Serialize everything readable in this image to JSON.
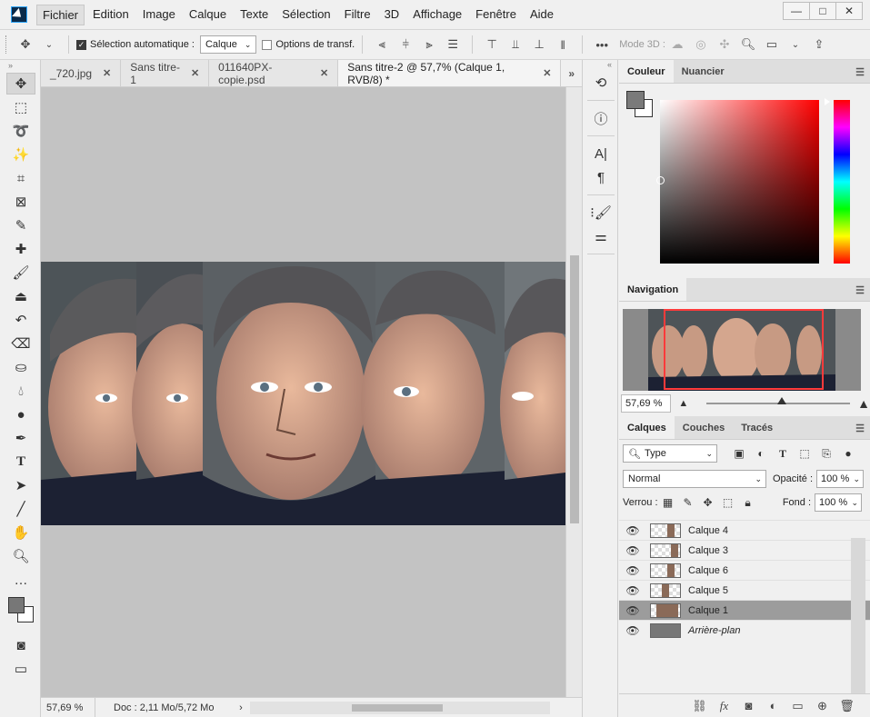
{
  "menubar": {
    "items": [
      "Fichier",
      "Edition",
      "Image",
      "Calque",
      "Texte",
      "Sélection",
      "Filtre",
      "3D",
      "Affichage",
      "Fenêtre",
      "Aide"
    ],
    "active_index": 0,
    "window_controls": [
      "—",
      "□",
      "✕"
    ]
  },
  "options": {
    "auto_select_label": "Sélection automatique :",
    "auto_select_checked": true,
    "auto_select_target": "Calque",
    "transform_label": "Options de transf.",
    "transform_checked": false,
    "mode3d_label": "Mode 3D :",
    "more_label": "•••"
  },
  "tabs": [
    {
      "label": "_720.jpg",
      "active": false
    },
    {
      "label": "Sans titre-1",
      "active": false
    },
    {
      "label": "011640PX-copie.psd",
      "active": false
    },
    {
      "label": "Sans titre-2 @ 57,7% (Calque 1, RVB/8) *",
      "active": true
    }
  ],
  "status": {
    "zoom": "57,69 %",
    "doc": "Doc : 2,11 Mo/5,72 Mo"
  },
  "panels": {
    "color": {
      "tabs": [
        "Couleur",
        "Nuancier"
      ],
      "active": 0
    },
    "navigation": {
      "tabs": [
        "Navigation"
      ],
      "zoom": "57,69 %"
    },
    "layers": {
      "tabs": [
        "Calques",
        "Couches",
        "Tracés"
      ],
      "filter_type": "Type",
      "blend_mode": "Normal",
      "opacity_label": "Opacité :",
      "opacity_value": "100 %",
      "lock_label": "Verrou :",
      "fill_label": "Fond :",
      "fill_value": "100 %",
      "items": [
        {
          "name": "Calque 4",
          "selected": false,
          "italic": false,
          "locked": false
        },
        {
          "name": "Calque 3",
          "selected": false,
          "italic": false,
          "locked": false
        },
        {
          "name": "Calque 6",
          "selected": false,
          "italic": false,
          "locked": false
        },
        {
          "name": "Calque 5",
          "selected": false,
          "italic": false,
          "locked": false
        },
        {
          "name": "Calque 1",
          "selected": true,
          "italic": false,
          "locked": false
        },
        {
          "name": "Arrière-plan",
          "selected": false,
          "italic": true,
          "locked": true
        }
      ],
      "footer_fx": "fx"
    }
  },
  "tools": [
    "move-tool",
    "marquee-tool",
    "lasso-tool",
    "magic-wand-tool",
    "crop-tool",
    "frame-tool",
    "eyedropper-tool",
    "healing-tool",
    "brush-tool",
    "stamp-tool",
    "history-brush-tool",
    "eraser-tool",
    "paint-bucket-tool",
    "blur-tool",
    "dodge-tool",
    "pen-tool",
    "type-tool",
    "path-select-tool",
    "line-tool",
    "hand-tool",
    "zoom-tool",
    "more-tools"
  ],
  "colors": {
    "foreground": "#7a7a7a",
    "background": "#ffffff",
    "accent_nav": "#ff3b3b"
  }
}
